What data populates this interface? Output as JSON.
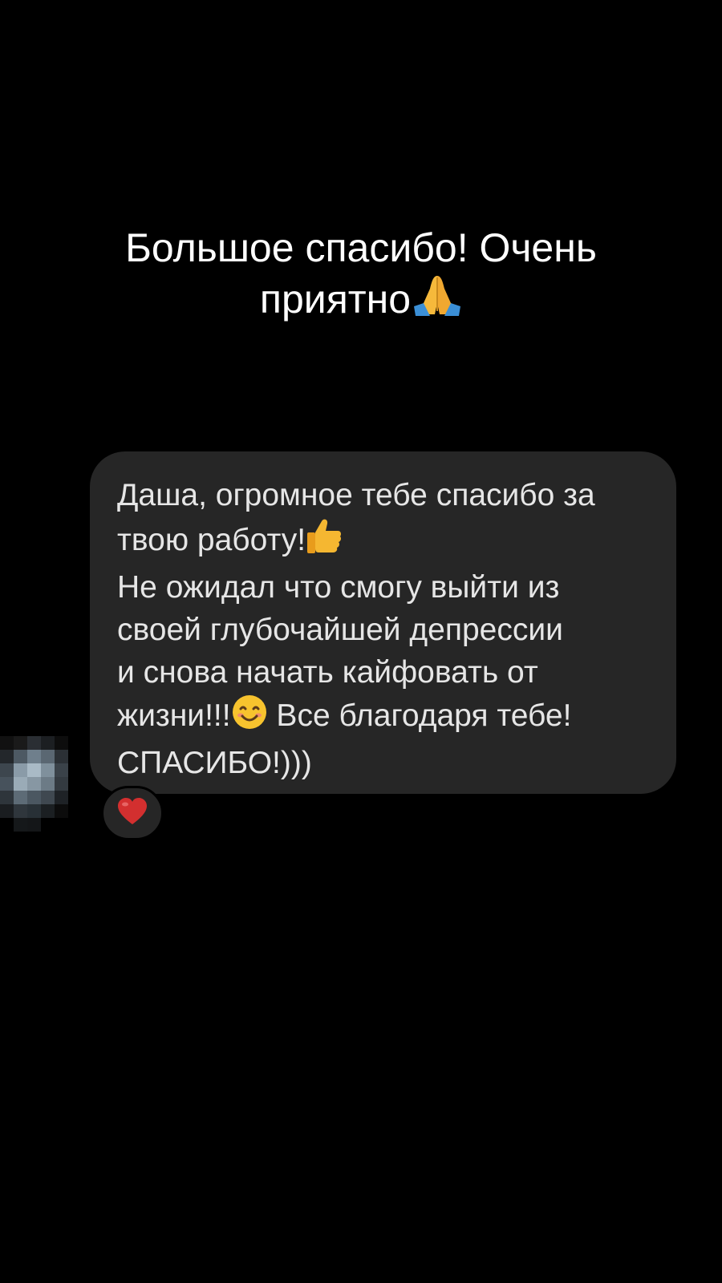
{
  "reply": {
    "line1": "Большое спасибо! Очень",
    "line2": "приятно",
    "icon": "folded-hands-icon"
  },
  "message": {
    "lines": [
      {
        "text": "Даша, огромное тебе спасибо за"
      },
      {
        "text": "твою работу!",
        "icon": "thumbs-up-icon"
      },
      {
        "text": "Не ожидал что смогу выйти из"
      },
      {
        "text": "своей глубочайшей депрессии"
      },
      {
        "text": "и снова начать кайфовать от"
      },
      {
        "text": "жизни!!!",
        "icon": "smiling-face-icon",
        "after": " Все благодаря тебе!"
      },
      {
        "text": "СПАСИБО!)))"
      }
    ]
  },
  "reaction": {
    "icon": "heart-icon",
    "color": "#d32f2f"
  },
  "avatar": {
    "icon": "pixelated-avatar"
  },
  "colors": {
    "background": "#000000",
    "bubble": "#262626",
    "text": "#e6e6e6"
  }
}
